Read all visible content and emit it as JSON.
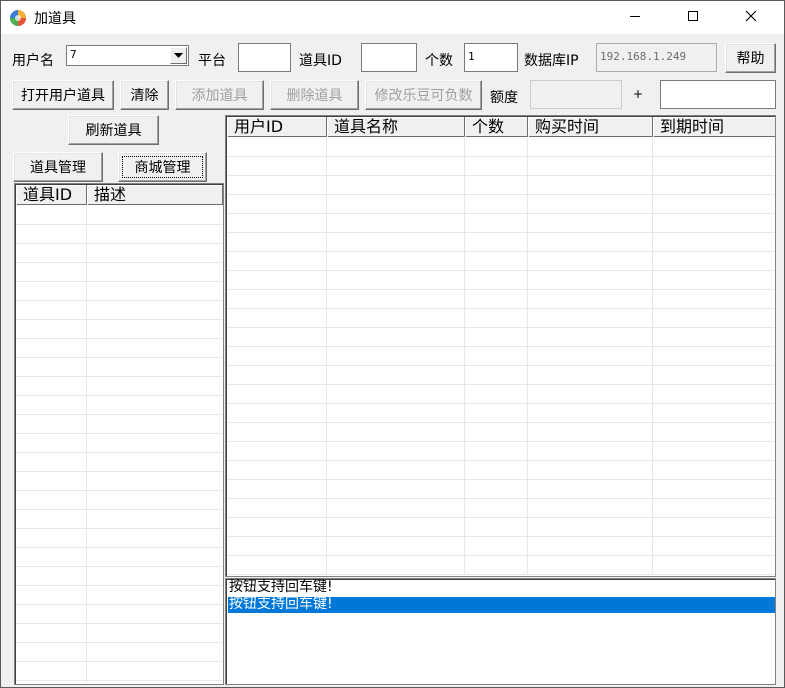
{
  "window": {
    "title": "加道具",
    "icons": {
      "app": "colorful-ball-icon",
      "minimize": "minimize-icon",
      "maximize": "maximize-icon",
      "close": "close-icon"
    }
  },
  "toolbar": {
    "username_label": "用户名",
    "username_value": "7",
    "platform_label": "平台",
    "platform_value": "",
    "item_id_label": "道具ID",
    "item_id_value": "",
    "count_label": "个数",
    "count_value": "1",
    "db_ip_label": "数据库IP",
    "db_ip_value": "192.168.1.249",
    "help_button": "帮助",
    "open_user_items_button": "打开用户道具",
    "clear_button": "清除",
    "add_item_button": "添加道具",
    "delete_item_button": "删除道具",
    "modify_ledou_button": "修改乐豆可负数",
    "quota_label": "额度",
    "quota_value": "",
    "plus_label": "+",
    "extra_value": ""
  },
  "left_panel": {
    "refresh_button": "刷新道具",
    "item_manage_button": "道具管理",
    "shop_manage_button": "商城管理",
    "columns": [
      "道具ID",
      "描述"
    ],
    "rows": []
  },
  "main_table": {
    "columns": [
      "用户ID",
      "道具名称",
      "个数",
      "购买时间",
      "到期时间"
    ],
    "rows": []
  },
  "log": {
    "lines": [
      "按钮支持回车键!",
      "按钮支持回车键!"
    ],
    "selected_index": 1
  },
  "colors": {
    "selection": "#0078d7",
    "window_bg": "#f0f0f0"
  }
}
